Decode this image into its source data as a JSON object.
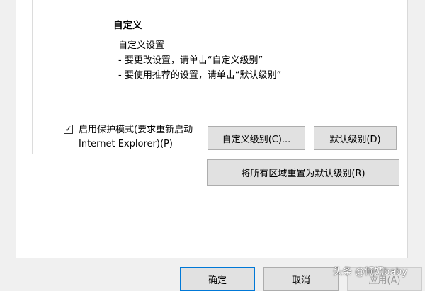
{
  "custom_section": {
    "title": "自定义",
    "desc_lines": [
      "自定义设置",
      "- 要更改设置，请单击“自定义级别”",
      "- 要使用推荐的设置，请单击“默认级别”"
    ]
  },
  "protected_mode": {
    "checked": true,
    "check_glyph": "☑",
    "label_line1": "启用保护模式(要求重新启动",
    "label_line2": "Internet Explorer)(P)"
  },
  "buttons": {
    "custom_level": "自定义级别(C)...",
    "default_level": "默认级别(D)",
    "reset_all": "将所有区域重置为默认级别(R)",
    "ok": "确定",
    "cancel": "取消",
    "apply": "应用(A)"
  },
  "watermark": "头条 @倾嫣baby"
}
